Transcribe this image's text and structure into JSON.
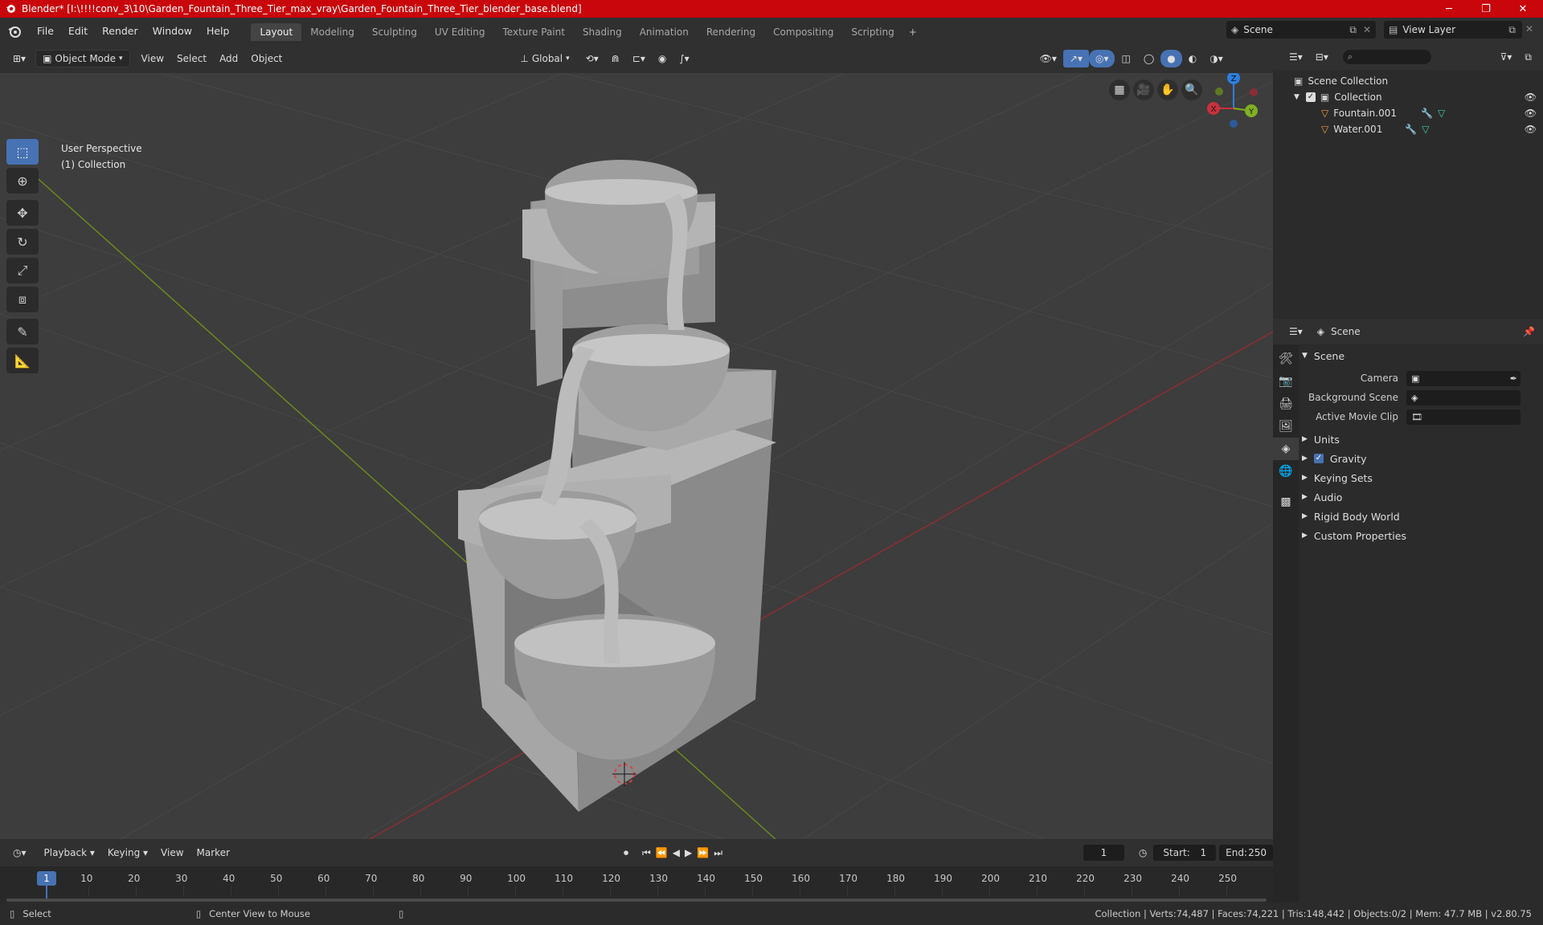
{
  "titlebar": {
    "title": "Blender* [I:\\!!!!conv_3\\10\\Garden_Fountain_Three_Tier_max_vray\\Garden_Fountain_Three_Tier_blender_base.blend]",
    "minimize": "─",
    "maximize": "❐",
    "close": "✕"
  },
  "menu": {
    "file": "File",
    "edit": "Edit",
    "render": "Render",
    "window": "Window",
    "help": "Help"
  },
  "workspaces": [
    "Layout",
    "Modeling",
    "Sculpting",
    "UV Editing",
    "Texture Paint",
    "Shading",
    "Animation",
    "Rendering",
    "Compositing",
    "Scripting"
  ],
  "workspace_add": "+",
  "scene": {
    "name": "Scene",
    "view_layer": "View Layer"
  },
  "viewport_header": {
    "mode": "Object Mode",
    "view": "View",
    "select": "Select",
    "add": "Add",
    "object": "Object",
    "orientation": "Global"
  },
  "viewport": {
    "perspective": "User Perspective",
    "collection": "(1) Collection"
  },
  "gizmo": {
    "z": "Z",
    "x": "X",
    "y": "Y"
  },
  "outliner": {
    "scene_collection": "Scene Collection",
    "collection": "Collection",
    "objects": [
      {
        "name": "Fountain.001"
      },
      {
        "name": "Water.001"
      }
    ]
  },
  "properties": {
    "header": "Scene",
    "section": "Scene",
    "fields": [
      {
        "label": "Camera"
      },
      {
        "label": "Background Scene"
      },
      {
        "label": "Active Movie Clip"
      }
    ],
    "panels": [
      "Units",
      "Gravity",
      "Keying Sets",
      "Audio",
      "Rigid Body World",
      "Custom Properties"
    ]
  },
  "timeline": {
    "playback": "Playback",
    "keying": "Keying",
    "view": "View",
    "marker": "Marker",
    "current_frame": "1",
    "start_label": "Start:",
    "start": "1",
    "end_label": "End:",
    "end": "250",
    "ticks": [
      "1",
      "10",
      "20",
      "30",
      "40",
      "50",
      "60",
      "70",
      "80",
      "90",
      "100",
      "110",
      "120",
      "130",
      "140",
      "150",
      "160",
      "170",
      "180",
      "190",
      "200",
      "210",
      "220",
      "230",
      "240",
      "250"
    ]
  },
  "statusbar": {
    "select": "Select",
    "center": "Center View to Mouse",
    "stats": "Collection | Verts:74,487 | Faces:74,221 | Tris:148,442 | Objects:0/2 | Mem: 47.7 MB | v2.80.75"
  },
  "colors": {
    "title_bar": "#c8060b",
    "accent": "#4772b3",
    "x_axis": "#c8303c",
    "y_axis": "#80b020",
    "z_axis": "#2b7fe0",
    "object_icon": "#e8a03a"
  }
}
